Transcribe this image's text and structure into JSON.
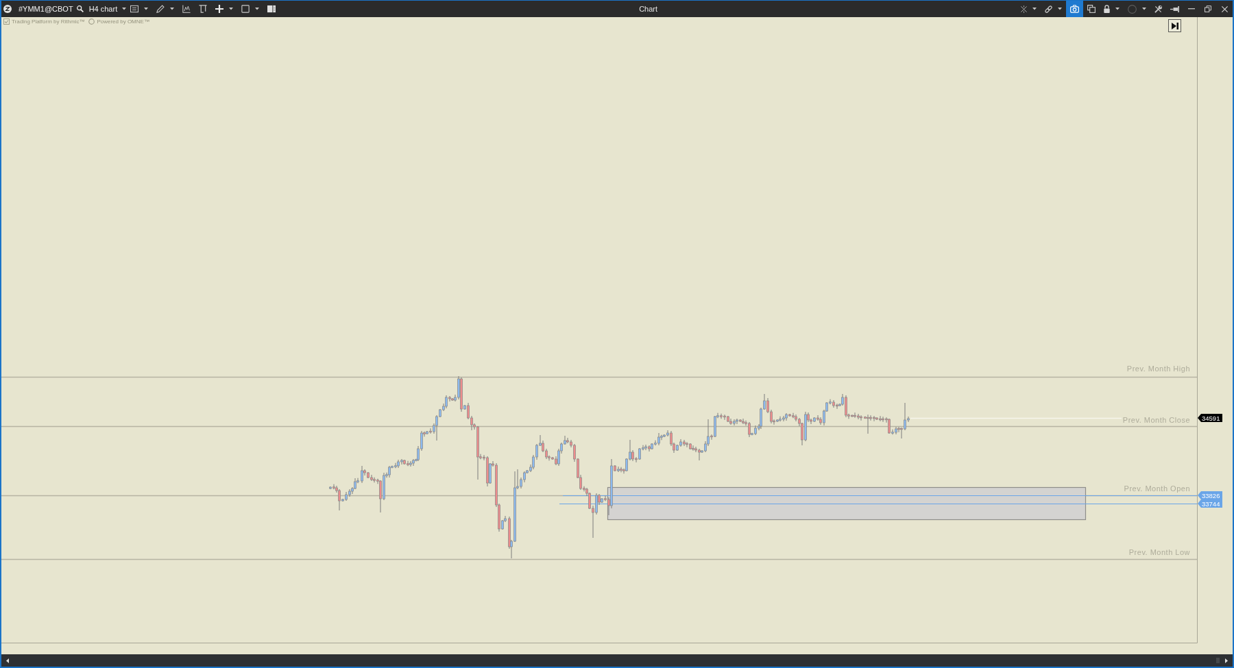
{
  "window": {
    "title": "Chart"
  },
  "toolbar": {
    "instrument": "#YMM1@CBOT",
    "timeframe": "H4 chart",
    "tools": [
      {
        "dropdown": true
      },
      {
        "dropdown": true
      },
      {
        "dropdown": false
      },
      {
        "dropdown": false
      },
      {
        "dropdown": true
      },
      {
        "dropdown": true
      },
      {
        "dropdown": false
      }
    ]
  },
  "actions": [
    {
      "dropdown": true,
      "selected": false
    },
    {
      "dropdown": true,
      "selected": false
    },
    {
      "dropdown": false,
      "selected": true
    },
    {
      "dropdown": false,
      "selected": false
    },
    {
      "dropdown": true,
      "selected": false
    },
    {
      "dropdown": true,
      "selected": false
    },
    {
      "dropdown": false,
      "selected": false
    },
    {
      "dropdown": false,
      "selected": false
    }
  ],
  "chart": {
    "branding": [
      "Trading Platform by Rithmic™",
      "Powered by OMNE™"
    ],
    "levels": [
      {
        "label": "Prev. Month High"
      },
      {
        "label": "Prev. Month Close"
      },
      {
        "label": "Prev. Month Open"
      },
      {
        "label": "Prev. Month Low"
      }
    ],
    "price_tags": [
      {
        "value": "34591",
        "color": "#000000"
      },
      {
        "value": "33826",
        "color": "#6aa5e8"
      },
      {
        "value": "33744",
        "color": "#6aa5e8"
      }
    ]
  }
}
